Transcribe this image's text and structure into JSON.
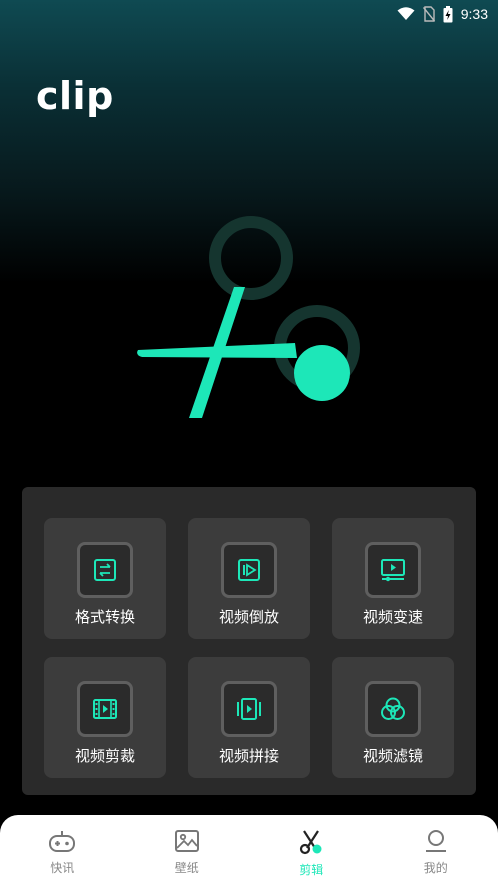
{
  "status_bar": {
    "time": "9:33"
  },
  "app": {
    "title": "clip"
  },
  "colors": {
    "accent": "#1de7b8",
    "tile_bg": "#3c3c3c",
    "panel_bg": "#2a2a2a"
  },
  "tools": [
    {
      "label": "格式转换",
      "icon": "format-convert-icon"
    },
    {
      "label": "视频倒放",
      "icon": "reverse-play-icon"
    },
    {
      "label": "视频变速",
      "icon": "speed-change-icon"
    },
    {
      "label": "视频剪裁",
      "icon": "film-crop-icon"
    },
    {
      "label": "视频拼接",
      "icon": "video-join-icon"
    },
    {
      "label": "视频滤镜",
      "icon": "filter-icon"
    }
  ],
  "tabs": [
    {
      "label": "快讯",
      "icon": "gamepad-icon",
      "active": false
    },
    {
      "label": "壁纸",
      "icon": "image-icon",
      "active": false
    },
    {
      "label": "剪辑",
      "icon": "scissors-icon",
      "active": true
    },
    {
      "label": "我的",
      "icon": "person-icon",
      "active": false
    }
  ]
}
